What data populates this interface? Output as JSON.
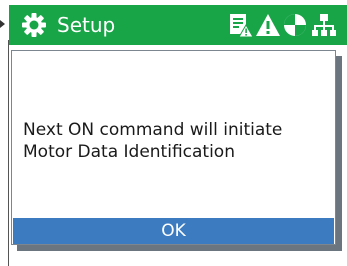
{
  "header": {
    "title": "Setup",
    "icons": [
      "gear-icon",
      "document-warning-icon",
      "warning-icon",
      "status-pie-icon",
      "network-icon"
    ],
    "background_color": "#18a548"
  },
  "dialog": {
    "message_line1": "Next ON command will initiate",
    "message_line2": "Motor Data Identification",
    "ok_label": "OK",
    "button_color": "#3c7bc0"
  }
}
